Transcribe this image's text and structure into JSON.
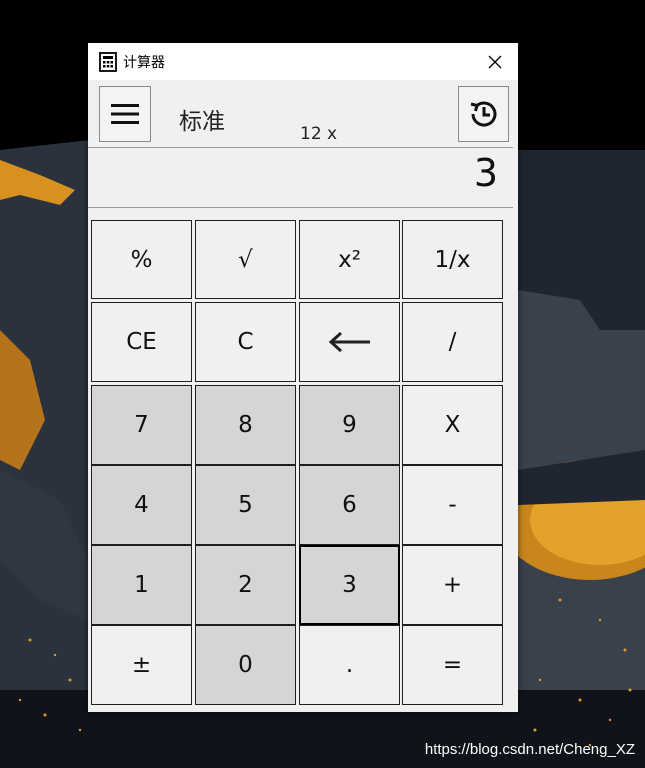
{
  "window": {
    "title": "计算器"
  },
  "toolbar": {
    "mode": "标准",
    "expression": "12 x"
  },
  "display": {
    "value": "3"
  },
  "watermark": "https://blog.csdn.net/Cheng_XZ",
  "keys": {
    "percent": "%",
    "sqrt": "√",
    "square": "x²",
    "reciprocal": "1/x",
    "clear_entry": "CE",
    "clear": "C",
    "divide": "/",
    "seven": "7",
    "eight": "8",
    "nine": "9",
    "multiply": "X",
    "four": "4",
    "five": "5",
    "six": "6",
    "minus": "-",
    "one": "1",
    "two": "2",
    "three": "3",
    "plus": "+",
    "negate": "±",
    "zero": "0",
    "decimal": ".",
    "equals": "="
  }
}
